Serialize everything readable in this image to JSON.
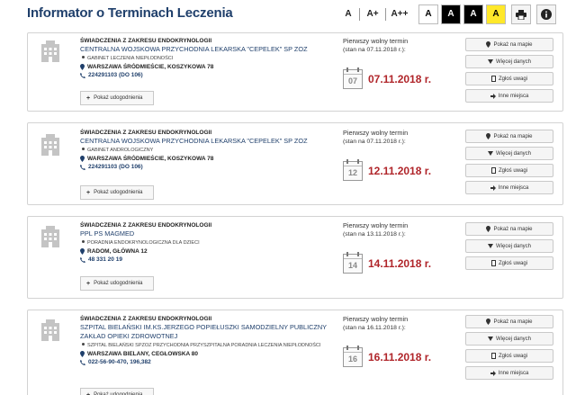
{
  "header": {
    "title": "Informator o Terminach Leczenia",
    "font_small": "A",
    "font_medium": "A+",
    "font_large": "A++",
    "contrast_labels": [
      "A",
      "A",
      "A",
      "A"
    ]
  },
  "common": {
    "term_label": "Pierwszy wolny termin",
    "updates_label": "Pokaż udogodnienia",
    "actions": {
      "map": "Pokaż na mapie",
      "more": "Więcej danych",
      "report": "Zgłoś uwagi",
      "other": "Inne miejsca"
    }
  },
  "results": [
    {
      "service": "ŚWIADCZENIA Z ZAKRESU ENDOKRYNOLOGII",
      "institution": "CENTRALNA WOJSKOWA PRZYCHODNIA LEKARSKA \"CEPELEK\" SP ZOZ",
      "department": "GABINET LECZENIA NIEPŁODNOŚCI",
      "address": "WARSZAWA ŚRÓDMIEŚCIE, KOSZYKOWA 78",
      "phone": "224291103 (DO 106)",
      "as_of": "(stan na 07.11.2018 r.):",
      "cal_day": "07",
      "date": "07.11.2018 r."
    },
    {
      "service": "ŚWIADCZENIA Z ZAKRESU ENDOKRYNOLOGII",
      "institution": "CENTRALNA WOJSKOWA PRZYCHODNIA LEKARSKA \"CEPELEK\" SP ZOZ",
      "department": "GABINET ANDROLOGICZNY",
      "address": "WARSZAWA ŚRÓDMIEŚCIE, KOSZYKOWA 78",
      "phone": "224291103 (DO 106)",
      "as_of": "(stan na 07.11.2018 r.):",
      "cal_day": "12",
      "date": "12.11.2018 r."
    },
    {
      "service": "ŚWIADCZENIA Z ZAKRESU ENDOKRYNOLOGII",
      "institution": "PPL PS MAGMED",
      "department": "PORADNIA ENDOKRYNOLOGICZNA DLA DZIECI",
      "address": "RADOM, GŁÓWNA 12",
      "phone": "48 331 20 19",
      "as_of": "(stan na 13.11.2018 r.):",
      "cal_day": "14",
      "date": "14.11.2018 r."
    },
    {
      "service": "ŚWIADCZENIA Z ZAKRESU ENDOKRYNOLOGII",
      "institution": "SZPITAL BIELAŃSKI IM.KS.JERZEGO POPIEŁUSZKI SAMODZIELNY PUBLICZNY ZAKŁAD OPIEKI ZDROWOTNEJ",
      "department": "SZPITAL BIELAŃSKI SPZOZ PRZYCHODNIA PRZYSZPITALNA PORADNIA LECZENIA NIEPŁODNOŚCI",
      "address": "WARSZAWA BIELANY, CEGŁOWSKA 80",
      "phone": "022-56-90-470, 196,382",
      "as_of": "(stan na 16.11.2018 r.):",
      "cal_day": "16",
      "date": "16.11.2018 r."
    }
  ],
  "colors": {
    "title": "#1f3f6b",
    "date": "#b0252a",
    "contrast_yellow": "#ffe82a"
  }
}
